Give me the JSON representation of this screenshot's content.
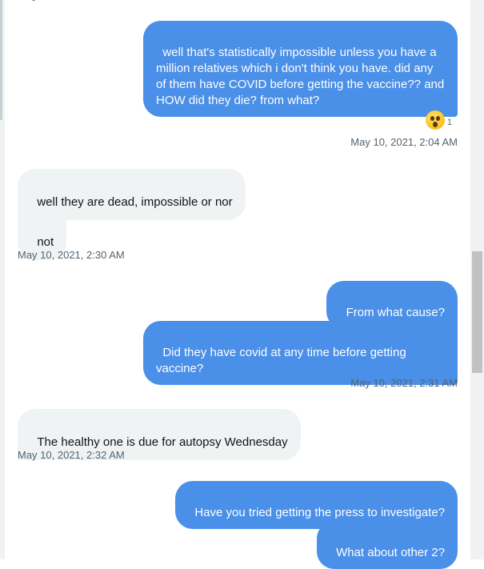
{
  "messages": {
    "m1": {
      "text": "well that's statistically impossible unless you have a million relatives which i don't think you have. did any of them have COVID before getting the vaccine?? and HOW did they die? from what?",
      "direction": "sent"
    },
    "m1_reaction": {
      "icon": "astonished-face-emoji",
      "count": "1"
    },
    "m1_time": "May 10, 2021, 2:04 AM",
    "m2": {
      "text": "well they are dead, impossible or nor",
      "direction": "received"
    },
    "m3": {
      "text": "not",
      "direction": "received"
    },
    "m3_time": "May 10, 2021, 2:30 AM",
    "m4": {
      "text": "From what cause?",
      "direction": "sent"
    },
    "m5": {
      "text": "Did they have covid at any time before getting vaccine?",
      "direction": "sent"
    },
    "m5_time": "May 10, 2021, 2:31 AM",
    "m6": {
      "text": "The healthy one is due for autopsy Wednesday",
      "direction": "received"
    },
    "m6_time": "May 10, 2021, 2:32 AM",
    "m7": {
      "text": "Have you tried getting the press to investigate?",
      "direction": "sent"
    },
    "m8": {
      "text": "What about other 2?",
      "direction": "sent"
    }
  },
  "colors": {
    "sent_bubble": "#4a8fe8",
    "received_bubble": "#eff3f4",
    "timestamp": "#536471"
  }
}
